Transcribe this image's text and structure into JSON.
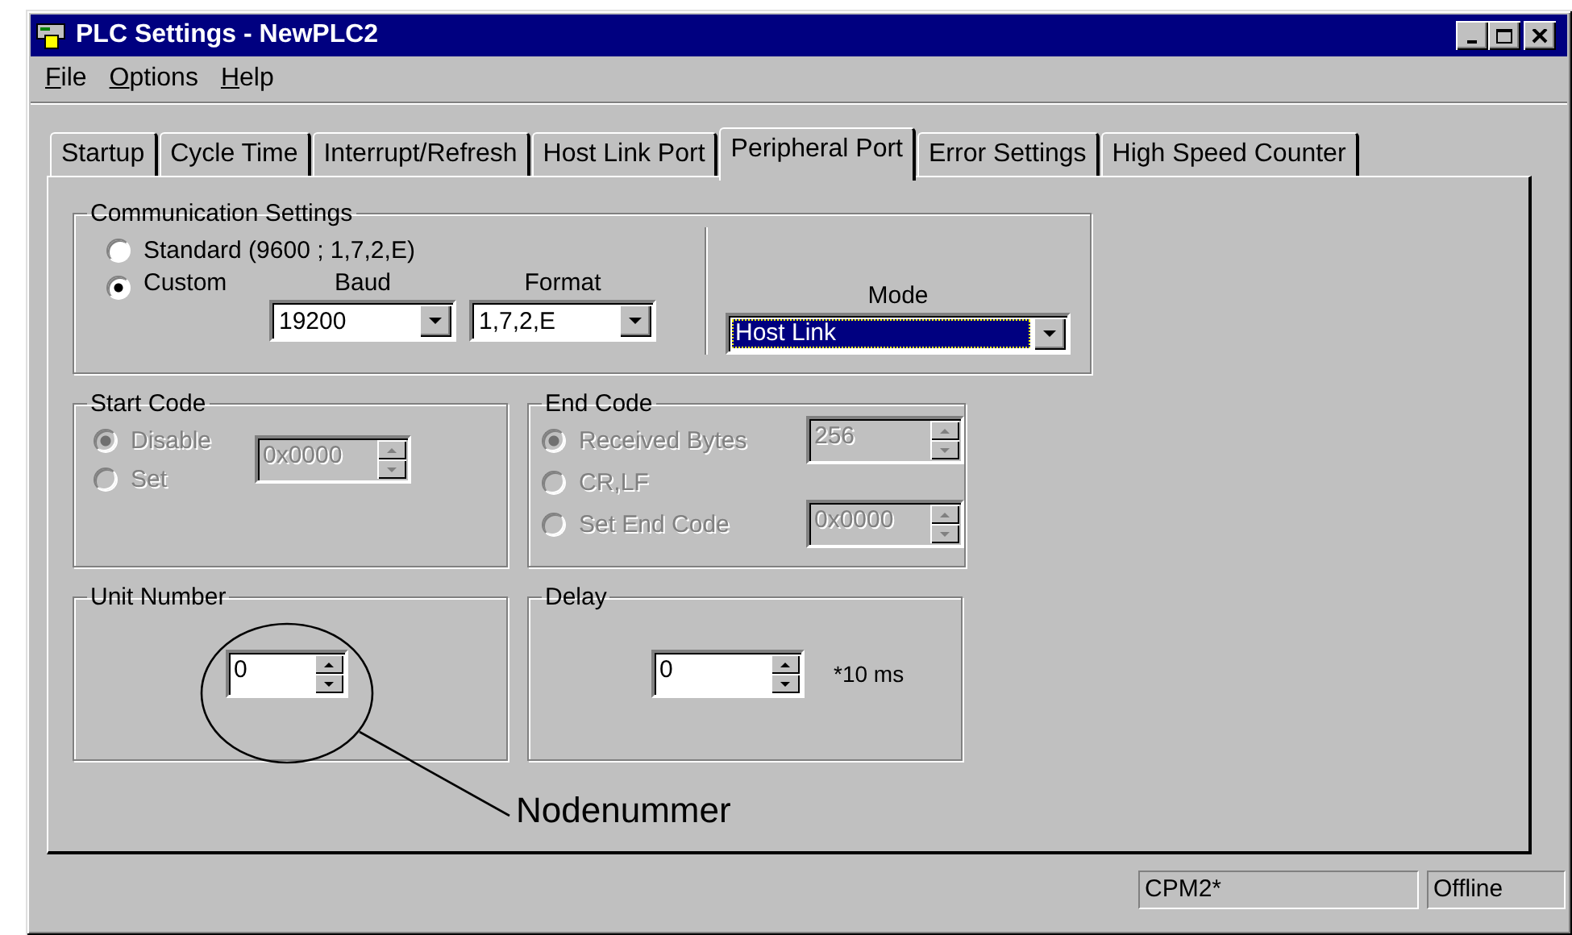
{
  "window": {
    "title": "PLC Settings - NewPLC2"
  },
  "menu": [
    {
      "label": "File"
    },
    {
      "label": "Options"
    },
    {
      "label": "Help"
    }
  ],
  "tabs": [
    {
      "label": "Startup",
      "selected": false
    },
    {
      "label": "Cycle Time",
      "selected": false
    },
    {
      "label": "Interrupt/Refresh",
      "selected": false
    },
    {
      "label": "Host Link Port",
      "selected": false
    },
    {
      "label": "Peripheral Port",
      "selected": true
    },
    {
      "label": "Error Settings",
      "selected": false
    },
    {
      "label": "High Speed Counter",
      "selected": false
    }
  ],
  "communication_settings": {
    "title": "Communication Settings",
    "options": [
      {
        "label": "Standard (9600 ; 1,7,2,E)",
        "selected": false
      },
      {
        "label": "Custom",
        "selected": true
      }
    ],
    "baud": {
      "label": "Baud",
      "value": "19200"
    },
    "format": {
      "label": "Format",
      "value": "1,7,2,E"
    },
    "mode": {
      "label": "Mode",
      "value": "Host Link",
      "focused": true
    }
  },
  "start_code": {
    "title": "Start Code",
    "disabled": true,
    "options": [
      {
        "label": "Disable",
        "selected": true
      },
      {
        "label": "Set",
        "selected": false
      }
    ],
    "value": "0x0000"
  },
  "end_code": {
    "title": "End Code",
    "disabled": true,
    "options": [
      {
        "label": "Received Bytes",
        "selected": true,
        "value": "256"
      },
      {
        "label": "CR,LF",
        "selected": false
      },
      {
        "label": "Set End Code",
        "selected": false,
        "value": "0x0000"
      }
    ]
  },
  "unit_number": {
    "title": "Unit Number",
    "value": "0"
  },
  "delay": {
    "title": "Delay",
    "value": "0",
    "unit": "*10 ms"
  },
  "annotation": {
    "label": "Nodenummer"
  },
  "status_bar": [
    "CPM2*",
    "Offline"
  ]
}
